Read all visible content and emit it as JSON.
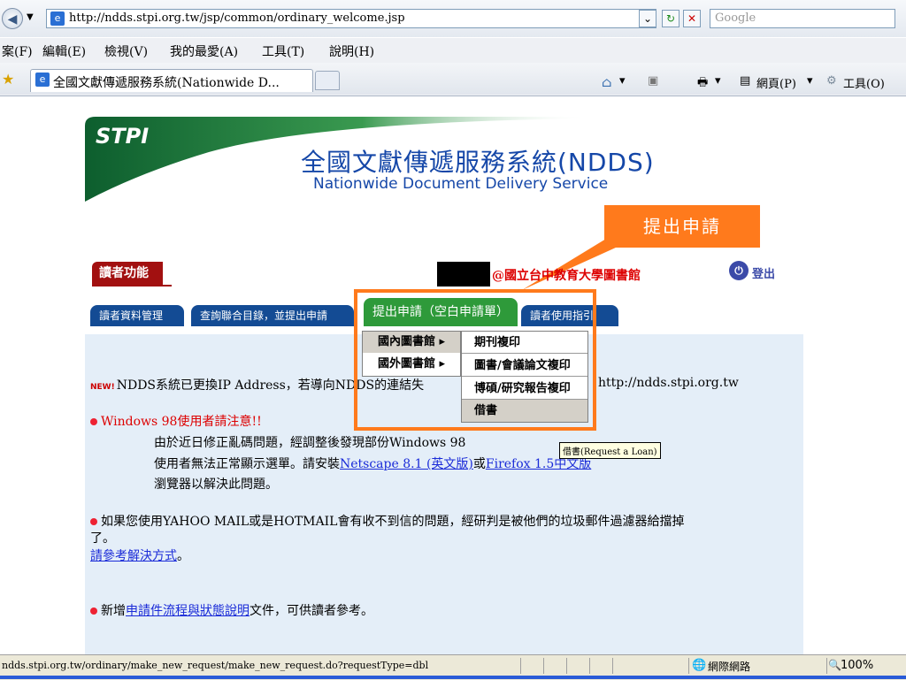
{
  "browser": {
    "url": "http://ndds.stpi.org.tw/jsp/common/ordinary_welcome.jsp",
    "search_placeholder": "Google",
    "menu": [
      "案(F)",
      "編輯(E)",
      "檢視(V)",
      "我的最愛(A)",
      "工具(T)",
      "說明(H)"
    ],
    "tab_title": "全國文獻傳遞服務系統(Nationwide D...",
    "toolbar_page": "網頁(P)",
    "toolbar_tools": "工具(O)",
    "status_url": "ndds.stpi.org.tw/ordinary/make_new_request/make_new_request.do?requestType=dbl",
    "status_zone": "網際網路",
    "zoom": "100%"
  },
  "header": {
    "logo": "STPI",
    "title_cn": "全國文獻傳遞服務系統(NDDS)",
    "title_en": "Nationwide Document Delivery Service"
  },
  "callout": "提出申請",
  "reader": {
    "label": "讀者功能",
    "library": "@國立台中教育大學圖書館",
    "logout": "登出"
  },
  "nav_tabs": [
    "讀者資料管理",
    "查詢聯合目錄，並提出申請",
    "提出申請（空白申請單）",
    "讀者使用指引"
  ],
  "dropdown": {
    "level1": [
      "國內圖書館",
      "國外圖書館"
    ],
    "level2": [
      "期刊複印",
      "圖書/會議論文複印",
      "博碩/研究報告複印",
      "借書"
    ],
    "tooltip": "借書(Request a Loan)"
  },
  "content": {
    "new_badge": "NEW!",
    "notice1": "NDDS系統已更換IP Address，若導向NDDS的連結失",
    "notice1_tail": "http://ndds.stpi.org.tw",
    "win98_title": "Windows 98使用者請注意!!",
    "win98_l1": "由於近日修正亂碼問題，經調整後發現部份Windows 98",
    "win98_l2a": "使用者無法正常顯示選單。請安裝",
    "win98_link1": "Netscape 8.1 (英文版)",
    "win98_or": "或",
    "win98_link2": "Firefox 1.5中文版",
    "win98_l3": "瀏覽器以解決此問題。",
    "mail_l1": "如果您使用YAHOO MAIL或是HOTMAIL會有收不到信的問題，經研判是被他們的垃圾郵件過濾器給擋掉",
    "mail_l2": "了。",
    "mail_link": "請參考解決方式",
    "mail_end": "。",
    "flow_a": "新增",
    "flow_link": "申請件流程與狀態說明",
    "flow_b": "文件，可供讀者參考。"
  },
  "colors": {
    "brand_blue": "#1547a8",
    "callout_orange": "#ff7a1c",
    "header_green": "#1f7a3a",
    "tab_blue": "#134b94",
    "tab_green": "#2e9a3a",
    "alert_red": "#dd0000"
  }
}
